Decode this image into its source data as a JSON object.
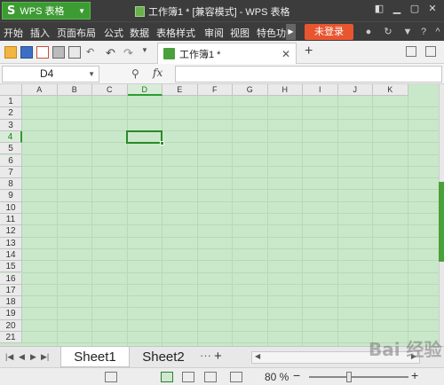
{
  "app": {
    "logo": "S",
    "name": "WPS 表格",
    "window_title": "工作簿1 * [兼容模式] - WPS 表格"
  },
  "menu": {
    "items": [
      "开始",
      "插入",
      "页面布局",
      "公式",
      "数据",
      "表格样式",
      "审阅",
      "视图",
      "特色功"
    ],
    "login": "未登录"
  },
  "document_tab": {
    "label": "工作簿1 *"
  },
  "formula_bar": {
    "cell_ref": "D4",
    "fx": "fx",
    "value": ""
  },
  "grid": {
    "columns": [
      "A",
      "B",
      "C",
      "D",
      "E",
      "F",
      "G",
      "H",
      "I",
      "J",
      "K"
    ],
    "rows": [
      "1",
      "2",
      "3",
      "4",
      "5",
      "6",
      "7",
      "8",
      "9",
      "10",
      "11",
      "12",
      "13",
      "14",
      "15",
      "16",
      "17",
      "18",
      "19",
      "20",
      "21"
    ],
    "selected_column": "D",
    "selected_row": "4",
    "background": "#c9e8c9"
  },
  "sheets": {
    "tabs": [
      "Sheet1",
      "Sheet2"
    ],
    "active": "Sheet1",
    "more": "···",
    "add": "+"
  },
  "status": {
    "zoom": "80 %",
    "minus": "−",
    "plus": "+",
    "zoom_fraction": 0.4
  },
  "watermark": "Bai 经验"
}
